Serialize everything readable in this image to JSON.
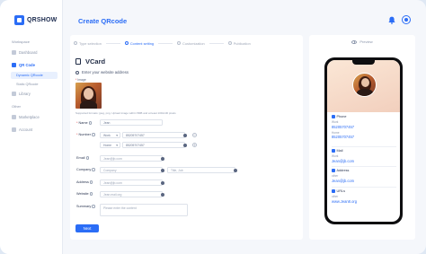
{
  "app": {
    "logo_text": "QRSHOW"
  },
  "sidebar": {
    "section_workspace": "Workspace",
    "dashboard": "Dashboard",
    "qr_code": "QR Code",
    "dynamic_qrcode": "Dynamic QRcode",
    "static_qrcode": "Static QRcode",
    "library": "Library",
    "section_other": "Other",
    "marketplace": "Marketplace",
    "account": "Account"
  },
  "header": {
    "title": "Create QRcode"
  },
  "steps": [
    "Type selection",
    "Content setting",
    "Customization",
    "Publication"
  ],
  "form": {
    "vcard_title": "VCard",
    "hint": "Enter your website address",
    "image_label": "Image",
    "image_hint": "Supported formats: jpeg, png. Upload image within 5MB and at least 100x100 pixels",
    "name": {
      "label": "Name",
      "value": "Jean"
    },
    "number": {
      "label": "Number",
      "rows": [
        {
          "type": "Work",
          "value": "85205707457"
        },
        {
          "type": "Home",
          "value": "85205707457"
        }
      ]
    },
    "email": {
      "label": "Email",
      "value": "Jean@jb.com"
    },
    "company": {
      "label": "Company",
      "placeholder": "Company",
      "title_placeholder": "Title, Job"
    },
    "address": {
      "label": "Address",
      "value": "Jean@jb.com"
    },
    "website": {
      "label": "Website",
      "value": "Jean.mail.org"
    },
    "summary": {
      "label": "Summary",
      "placeholder": "Please enter the content"
    },
    "next_label": "Next"
  },
  "preview": {
    "title": "Preview",
    "phone": {
      "section": "Phone",
      "items": [
        {
          "label": "Work",
          "value": "85205707457"
        },
        {
          "label": "Home",
          "value": "85205707457"
        }
      ]
    },
    "mail": {
      "section": "Mail",
      "label": "Work",
      "value": "Jean@jb.com"
    },
    "address": {
      "section": "Address",
      "label": "other",
      "value": "Jean@jb.com"
    },
    "urls": {
      "section": "URLs",
      "label": "other",
      "value": "www.Jean8.org"
    }
  },
  "colors": {
    "accent": "#2b6df6",
    "required": "#e5484d",
    "bg": "#f5f7fb"
  }
}
